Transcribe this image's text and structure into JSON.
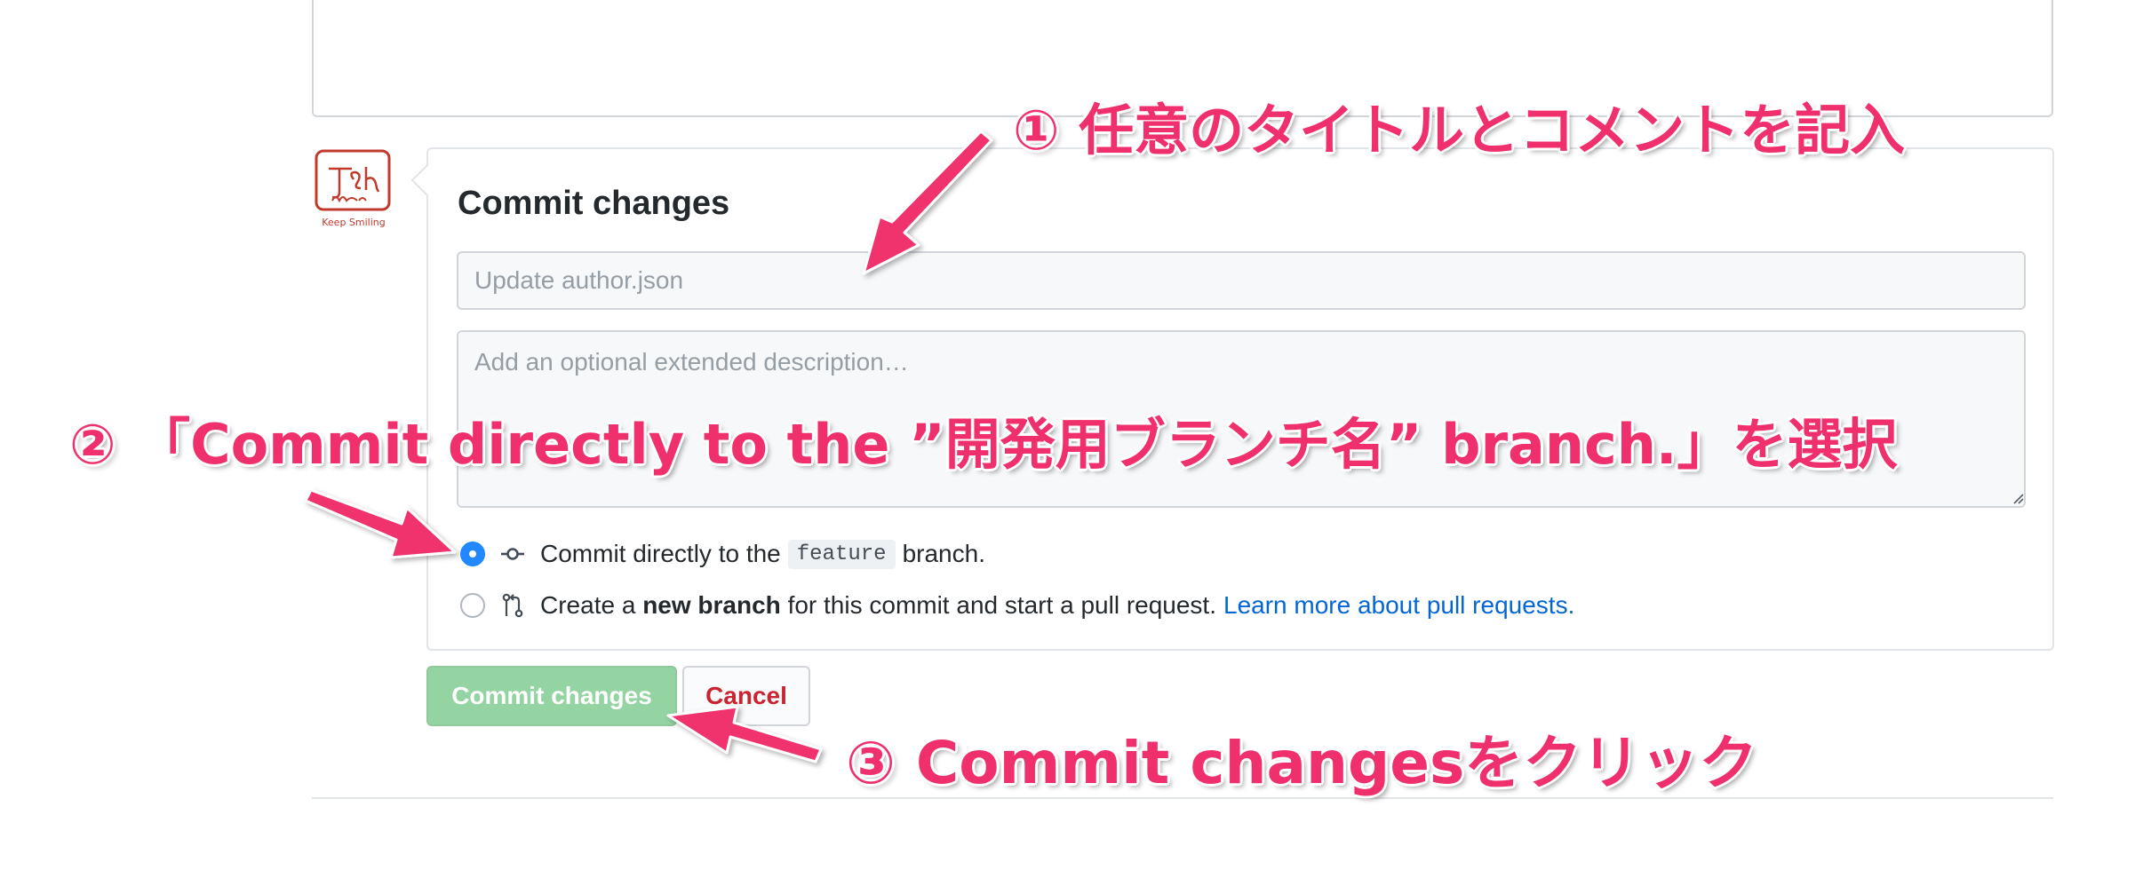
{
  "commit_form": {
    "title": "Commit changes",
    "summary_placeholder": "Update author.json",
    "description_placeholder": "Add an optional extended description…",
    "option_direct": {
      "prefix": "Commit directly to the",
      "branch": "feature",
      "suffix": "branch."
    },
    "option_new_branch": {
      "prefix": "Create a",
      "bold": "new branch",
      "suffix": "for this commit and start a pull request.",
      "link": "Learn more about pull requests."
    }
  },
  "buttons": {
    "commit": "Commit changes",
    "cancel": "Cancel"
  },
  "avatar": {
    "caption": "Keep Smiling"
  },
  "annotations": {
    "step1": "① 任意のタイトルとコメントを記入",
    "step2": "② 「Commit directly to the ”開発用ブランチ名” branch.」を選択",
    "step3": "③ Commit changesをクリック"
  },
  "colors": {
    "annotation": "#f0306d",
    "commit_button": "#94d3a2",
    "radio_selected": "#2188ff",
    "link": "#0366d6",
    "cancel_text": "#cb2431"
  }
}
